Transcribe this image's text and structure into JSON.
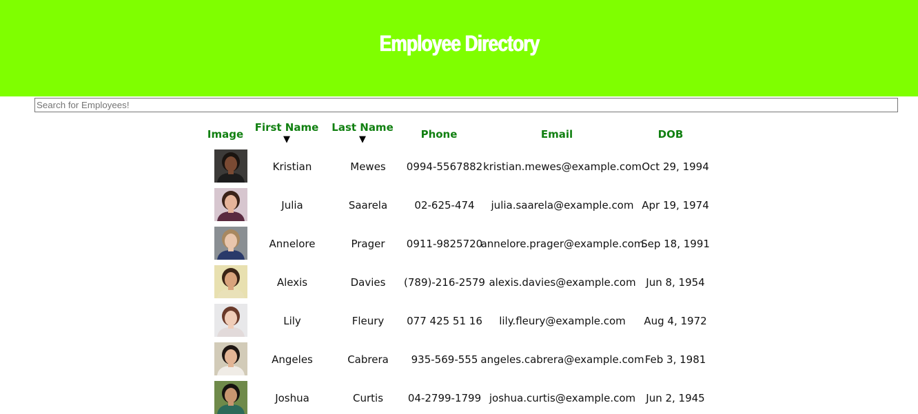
{
  "header": {
    "title": "Employee Directory",
    "bg": "#7fff00"
  },
  "search": {
    "placeholder": "Search for Employees!",
    "value": ""
  },
  "table": {
    "columns": {
      "image": "Image",
      "first": "First Name",
      "last": "Last Name",
      "phone": "Phone",
      "email": "Email",
      "dob": "DOB"
    },
    "sort_arrow": "▼",
    "rows": [
      {
        "first": "Kristian",
        "last": "Mewes",
        "phone": "0994-5567882",
        "email": "kristian.mewes@example.com",
        "dob": "Oct 29, 1994",
        "avatar": {
          "bg": "#3c3a38",
          "skin": "#7a4a33",
          "hair": "#1a1410",
          "shirt": "#1c1c1c"
        }
      },
      {
        "first": "Julia",
        "last": "Saarela",
        "phone": "02-625-474",
        "email": "julia.saarela@example.com",
        "dob": "Apr 19, 1974",
        "avatar": {
          "bg": "#d7c6cf",
          "skin": "#e6b49a",
          "hair": "#3a2218",
          "shirt": "#5a2a40"
        }
      },
      {
        "first": "Annelore",
        "last": "Prager",
        "phone": "0911-9825720",
        "email": "annelore.prager@example.com",
        "dob": "Sep 18, 1991",
        "avatar": {
          "bg": "#8a8f93",
          "skin": "#e9c6ad",
          "hair": "#a88860",
          "shirt": "#2a3a6a"
        }
      },
      {
        "first": "Alexis",
        "last": "Davies",
        "phone": "(789)-216-2579",
        "email": "alexis.davies@example.com",
        "dob": "Jun 8, 1954",
        "avatar": {
          "bg": "#e8e0b0",
          "skin": "#d9a37c",
          "hair": "#3a2416",
          "shirt": "#e9e1b8"
        }
      },
      {
        "first": "Lily",
        "last": "Fleury",
        "phone": "077 425 51 16",
        "email": "lily.fleury@example.com",
        "dob": "Aug 4, 1972",
        "avatar": {
          "bg": "#e8e8ea",
          "skin": "#f0cdb8",
          "hair": "#6a3a2a",
          "shirt": "#e2dada"
        }
      },
      {
        "first": "Angeles",
        "last": "Cabrera",
        "phone": "935-569-555",
        "email": "angeles.cabrera@example.com",
        "dob": "Feb 3, 1981",
        "avatar": {
          "bg": "#d2cbb8",
          "skin": "#e2b494",
          "hair": "#1e1612",
          "shirt": "#f0ece6"
        }
      },
      {
        "first": "Joshua",
        "last": "Curtis",
        "phone": "04-2799-1799",
        "email": "joshua.curtis@example.com",
        "dob": "Jun 2, 1945",
        "avatar": {
          "bg": "#6f8a4a",
          "skin": "#c89670",
          "hair": "#15120f",
          "shirt": "#2c6a5a"
        }
      }
    ]
  }
}
